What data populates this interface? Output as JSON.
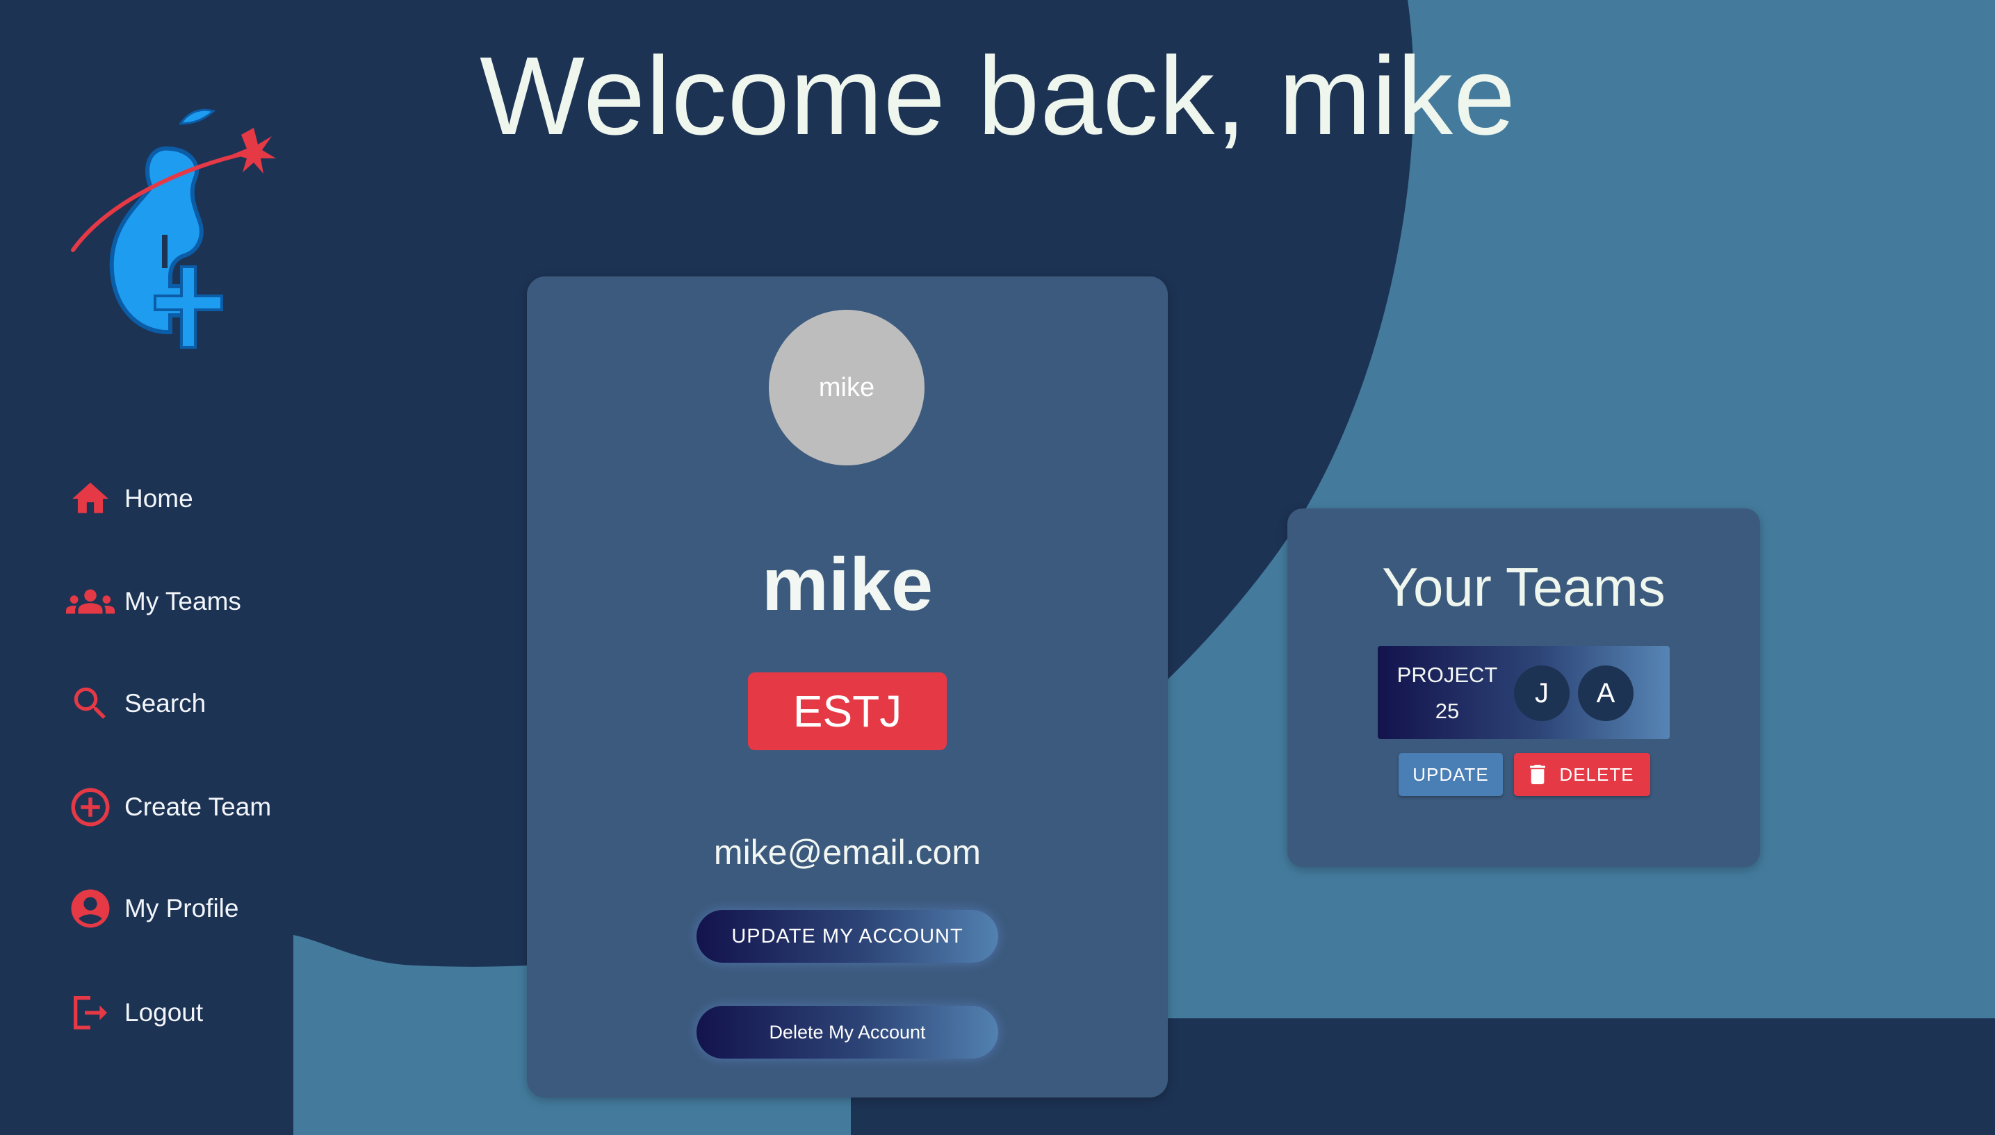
{
  "colors": {
    "background_dark": "#1d3354",
    "background_light": "#447b9d",
    "card": "#3c5a7d",
    "accent_red": "#e63946",
    "text_light": "#eef6ee",
    "avatar_gray": "#bdbdbd"
  },
  "header": {
    "welcome_text": "Welcome back, mike"
  },
  "sidebar": {
    "logo_icon": "pear-rocket-plus-logo",
    "items": [
      {
        "label": "Home",
        "icon": "home-icon"
      },
      {
        "label": "My Teams",
        "icon": "group-icon"
      },
      {
        "label": "Search",
        "icon": "search-icon"
      },
      {
        "label": "Create Team",
        "icon": "add-circle-icon"
      },
      {
        "label": "My Profile",
        "icon": "account-circle-icon"
      },
      {
        "label": "Logout",
        "icon": "logout-icon"
      }
    ]
  },
  "profile": {
    "avatar_text": "mike",
    "username": "mike",
    "personality_type": "ESTJ",
    "email": "mike@email.com",
    "update_button": "UPDATE MY ACCOUNT",
    "delete_button": "Delete My Account"
  },
  "teams": {
    "title": "Your Teams",
    "list": [
      {
        "name_line1": "PROJECT",
        "name_line2": "25",
        "members": [
          "J",
          "A"
        ],
        "update_label": "UPDATE",
        "delete_label": "DELETE"
      }
    ]
  }
}
